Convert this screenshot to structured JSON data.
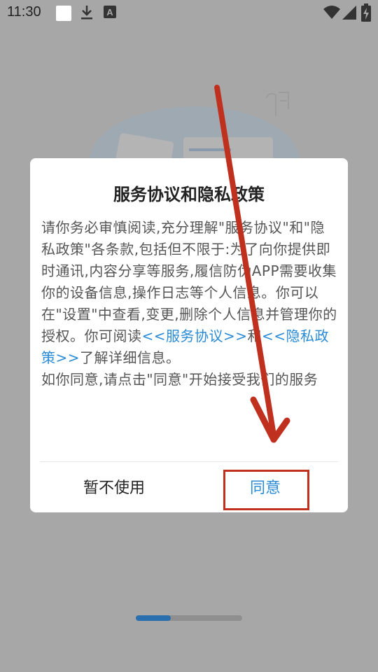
{
  "status_bar": {
    "time": "11:30",
    "icons": [
      "notification-square-icon",
      "download-icon",
      "font-a-icon",
      "wifi-icon",
      "signal-icon",
      "battery-charging-icon"
    ]
  },
  "dialog": {
    "title": "服务协议和隐私政策",
    "body": {
      "part1": "请你务必审慎阅读,充分理解\"服务协议\"和\"隐私政策\"各条款,包括但不限于:为了向你提供即时通讯,内容分享等服务,履信防伪APP需要收集你的设备信息,操作日志等个人信息。你可以在\"设置\"中查看,变更,删除个人信息并管理你的授权。你可阅读",
      "link_service": "<<服务协议>>",
      "and": "和",
      "link_privacy": "<<隐私政策>>",
      "part2": "了解详细信息。",
      "part3": "如你同意,请点击\"同意\"开始接受我们的服务"
    },
    "reject_label": "暂不使用",
    "agree_label": "同意"
  },
  "colors": {
    "accent": "#2a8ad6",
    "annotation": "#c0301f",
    "backdrop": "#a7a7a7"
  },
  "pager": {
    "pages": 3,
    "current": 1
  }
}
